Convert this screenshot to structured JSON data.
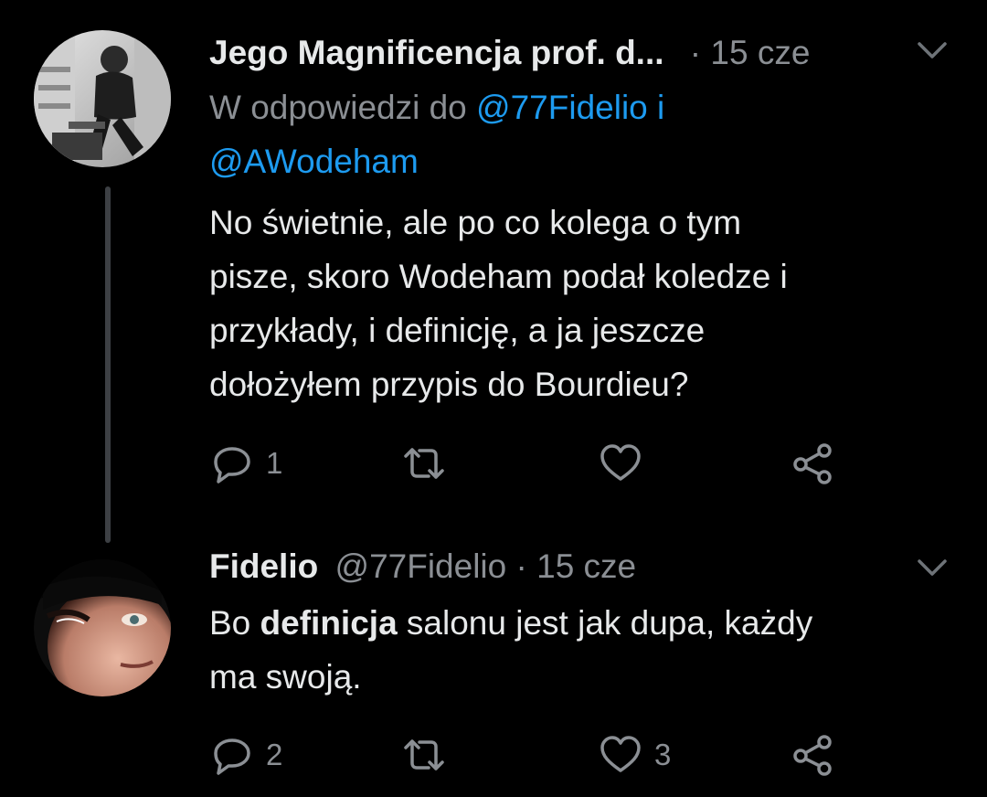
{
  "tweets": [
    {
      "name": "Jego Magnificencja prof. d...",
      "separator": "·",
      "time": "15 cze",
      "reply_prefix": "W odpowiedzi do",
      "reply_user1": "@77Fidelio",
      "reply_conj": "i",
      "reply_user2": "@AWodeham",
      "text_lines": [
        "No świetnie, ale po co kolega o tym",
        "pisze, skoro Wodeham podał koledze i",
        "przykłady, i definicję, a ja jeszcze",
        "dołożyłem przypis do Bourdieu?"
      ],
      "replies": "1",
      "retweets": "",
      "likes": ""
    },
    {
      "name": "Fidelio",
      "handle": "@77Fidelio",
      "separator": "·",
      "time": "15 cze",
      "text_line1_before": "Bo ",
      "text_line1_bold": "definicja",
      "text_line1_after": " salonu jest jak dupa, każdy",
      "text_line2": "ma swoją.",
      "replies": "2",
      "retweets": "",
      "likes": "3"
    }
  ],
  "icons": [
    "reply-icon",
    "retweet-icon",
    "like-icon",
    "share-icon",
    "chevron-down-icon"
  ],
  "colors": {
    "background": "#000000",
    "link": "#1d9bf0",
    "muted": "#8b8f94",
    "text": "#e7e9ea"
  }
}
